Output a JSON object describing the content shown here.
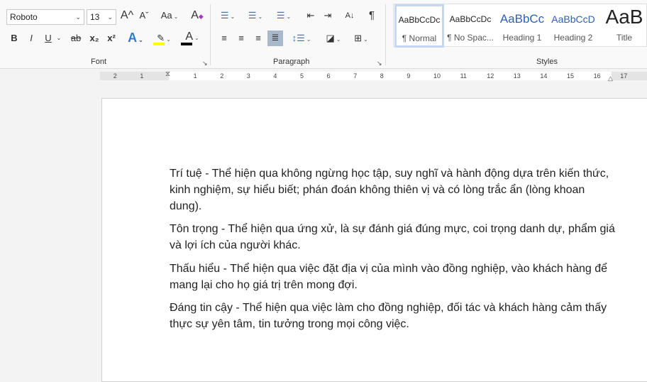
{
  "font": {
    "label": "Font",
    "font_name": "Roboto",
    "font_size": "13",
    "grow": "A^",
    "shrink": "Aˇ",
    "change_case": "Aa",
    "clear_format": "A",
    "bold": "B",
    "italic": "I",
    "underline": "U",
    "strike": "ab",
    "subscript": "x₂",
    "superscript": "x²",
    "text_effects": "A",
    "font_color": "A",
    "highlight_color": "#ffff00",
    "text_color": "#000000"
  },
  "paragraph": {
    "label": "Paragraph",
    "sort": "A↓",
    "pilcrow": "¶"
  },
  "styles": {
    "label": "Styles",
    "items": [
      {
        "preview": "AaBbCcDc",
        "name": "¶ Normal"
      },
      {
        "preview": "AaBbCcDc",
        "name": "¶ No Spac..."
      },
      {
        "preview": "AaBbCc",
        "name": "Heading 1"
      },
      {
        "preview": "AaBbCcD",
        "name": "Heading 2"
      },
      {
        "preview": "AaB",
        "name": "Title"
      }
    ]
  },
  "ruler": {
    "left": [
      "2",
      "1"
    ],
    "right": [
      "1",
      "2",
      "3",
      "4",
      "5",
      "6",
      "7",
      "8",
      "9",
      "10",
      "11",
      "12",
      "13",
      "14",
      "15",
      "16",
      "17"
    ]
  },
  "document": {
    "paragraphs": [
      "Trí tuệ - Thể hiện qua không ngừng học tập, suy nghĩ và hành động dựa trên kiến thức, kinh nghiệm, sự hiểu biết; phán đoán không thiên vị và có lòng trắc ẩn (lòng khoan dung).",
      "Tôn trọng - Thể hiện qua ứng xử, là sự đánh giá đúng mực, coi trọng danh dự, phẩm giá và lợi ích của người khác.",
      "Thấu hiểu - Thể hiện qua việc đặt địa vị của mình vào đồng nghiệp, vào khách hàng để mang lại cho họ giá trị trên mong đợi.",
      "Đáng tin cậy - Thể hiện qua việc làm cho đồng nghiệp, đối tác và khách hàng cảm thấy thực sự yên tâm, tin tưởng trong mọi công việc."
    ]
  }
}
